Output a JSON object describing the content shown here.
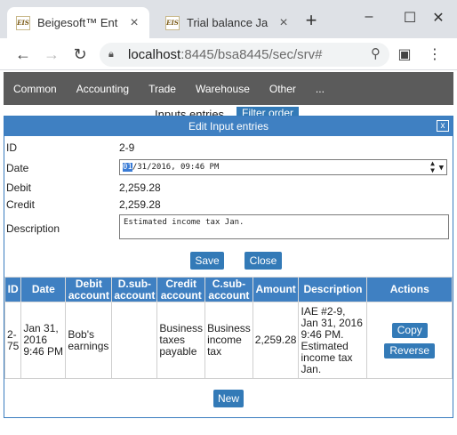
{
  "browser": {
    "tabs": [
      {
        "favicon": "EIS",
        "title": "Beigesoft™ Ent",
        "active": true
      },
      {
        "favicon": "EIS",
        "title": "Trial balance Ja",
        "active": false
      }
    ],
    "url_host": "localhost",
    "url_rest": ":8445/bsa8445/sec/srv#"
  },
  "menu": [
    "Common",
    "Accounting",
    "Trade",
    "Warehouse",
    "Other",
    "..."
  ],
  "background": {
    "title": "Inputs entries",
    "filter_button": "Filter order"
  },
  "dialog": {
    "title": "Edit Input entries",
    "close_glyph": "x",
    "fields": {
      "id_label": "ID",
      "id_value": "2-9",
      "date_label": "Date",
      "date_month": "01",
      "date_rest": "/31/2016, 09:46 PM",
      "debit_label": "Debit",
      "debit_value": "2,259.28",
      "credit_label": "Credit",
      "credit_value": "2,259.28",
      "description_label": "Description",
      "description_value": "Estimated income tax Jan."
    },
    "save_label": "Save",
    "close_label": "Close",
    "new_label": "New",
    "table": {
      "headers": [
        "ID",
        "Date",
        "Debit account",
        "D.sub-account",
        "Credit account",
        "C.sub-account",
        "Amount",
        "Description",
        "Actions"
      ],
      "rows": [
        {
          "id": "2-75",
          "date": "Jan 31, 2016 9:46 PM",
          "debit_account": "Bob's earnings",
          "d_sub_account": "",
          "credit_account": "Business taxes payable",
          "c_sub_account": "Business income tax",
          "amount": "2,259.28",
          "description": "IAE #2-9, Jan 31, 2016 9:46 PM. Estimated income tax Jan.",
          "copy_label": "Copy",
          "reverse_label": "Reverse"
        }
      ]
    }
  }
}
